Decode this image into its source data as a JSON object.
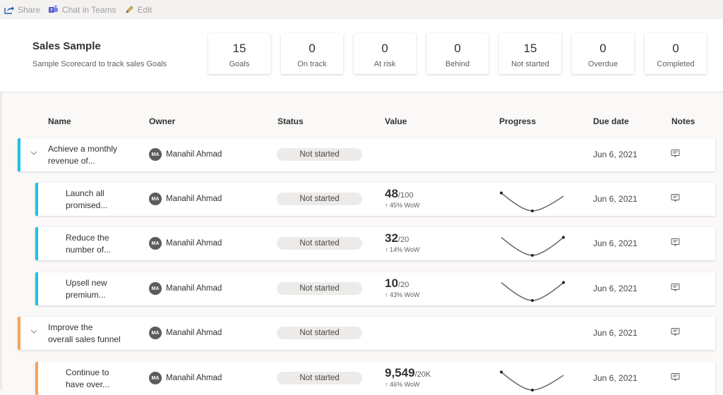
{
  "toolbar": {
    "items": [
      {
        "label": "Share",
        "icon": "share-icon"
      },
      {
        "label": "Chat in Teams",
        "icon": "teams-icon"
      },
      {
        "label": "Edit",
        "icon": "pencil-icon"
      }
    ]
  },
  "scorecard": {
    "title": "Sales Sample",
    "description": "Sample Scorecard to track sales Goals"
  },
  "summary": [
    {
      "count": "15",
      "label": "Goals"
    },
    {
      "count": "0",
      "label": "On track"
    },
    {
      "count": "0",
      "label": "At risk"
    },
    {
      "count": "0",
      "label": "Behind"
    },
    {
      "count": "15",
      "label": "Not started"
    },
    {
      "count": "0",
      "label": "Overdue"
    },
    {
      "count": "0",
      "label": "Completed"
    }
  ],
  "columns": {
    "name": "Name",
    "owner": "Owner",
    "status": "Status",
    "value": "Value",
    "progress": "Progress",
    "due_date": "Due date",
    "notes": "Notes"
  },
  "colors": {
    "group1": "#1ec0e8",
    "group2": "#f7a35c"
  },
  "goals": [
    {
      "level": "parent",
      "color": "#1ec0e8",
      "name_line1": "Achieve a monthly",
      "name_line2": "revenue of...",
      "owner_initials": "MA",
      "owner": "Manahil Ahmad",
      "status": "Not started",
      "value": "",
      "target": "",
      "wow": "",
      "sparkline": [],
      "due": "Jun 6, 2021"
    },
    {
      "level": "child",
      "color": "#1ec0e8",
      "name_line1": "Launch all",
      "name_line2": "promised...",
      "owner_initials": "MA",
      "owner": "Manahil Ahmad",
      "status": "Not started",
      "value": "48",
      "target": "/100",
      "wow": "↑ 45% WoW",
      "sparkline": [
        0.85,
        0.0,
        0.7
      ],
      "markers": [
        0,
        1
      ],
      "due": "Jun 6, 2021"
    },
    {
      "level": "child",
      "color": "#1ec0e8",
      "name_line1": "Reduce the",
      "name_line2": "number of...",
      "owner_initials": "MA",
      "owner": "Manahil Ahmad",
      "status": "Not started",
      "value": "32",
      "target": "/20",
      "wow": "↑ 14% WoW",
      "sparkline": [
        0.85,
        0.0,
        0.85
      ],
      "markers": [
        1,
        2
      ],
      "due": "Jun 6, 2021"
    },
    {
      "level": "child",
      "color": "#1ec0e8",
      "name_line1": "Upsell new",
      "name_line2": "premium...",
      "owner_initials": "MA",
      "owner": "Manahil Ahmad",
      "status": "Not started",
      "value": "10",
      "target": "/20",
      "wow": "↑ 43% WoW",
      "sparkline": [
        0.85,
        0.0,
        0.85
      ],
      "markers": [
        1,
        2
      ],
      "due": "Jun 6, 2021"
    },
    {
      "level": "parent",
      "color": "#f7a35c",
      "name_line1": "Improve the",
      "name_line2": "overall sales funnel",
      "owner_initials": "MA",
      "owner": "Manahil Ahmad",
      "status": "Not started",
      "value": "",
      "target": "",
      "wow": "",
      "sparkline": [],
      "due": "Jun 6, 2021"
    },
    {
      "level": "child",
      "color": "#f7a35c",
      "name_line1": "Continue to",
      "name_line2": "have over...",
      "owner_initials": "MA",
      "owner": "Manahil Ahmad",
      "status": "Not started",
      "value": "9,549",
      "target": "/20K",
      "wow": "↑ 46% WoW",
      "sparkline": [
        0.85,
        0.0,
        0.7
      ],
      "markers": [
        0,
        1
      ],
      "due": "Jun 6, 2021"
    }
  ]
}
